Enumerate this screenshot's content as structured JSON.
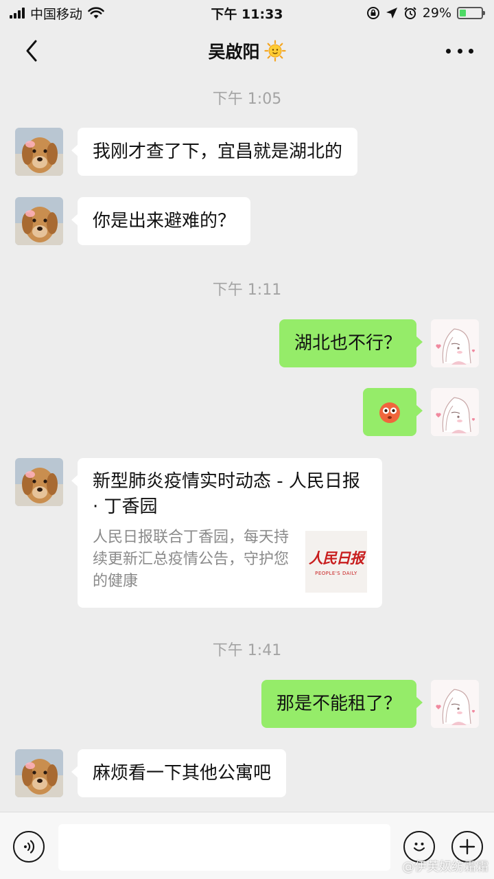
{
  "status_bar": {
    "carrier": "中国移动",
    "time": "下午 11:33",
    "battery": "29%",
    "battery_level": 0.29
  },
  "nav": {
    "title": "吴啟阳",
    "title_emoji": "sun-icon"
  },
  "chat": {
    "time_1": "下午 1:05",
    "msg_1": "我刚才查了下，宜昌就是湖北的",
    "msg_2": "你是出来避难的？",
    "time_2": "下午 1:11",
    "msg_3": "湖北也不行？",
    "msg_4_emoji": "flushed-face-icon",
    "card": {
      "title": "新型肺炎疫情实时动态 - 人民日报 · 丁香园",
      "description": "人民日报联合丁香园，每天持续更新汇总疫情公告，守护您的健康",
      "thumb_cn": "人民日报",
      "thumb_en": "PEOPLE'S DAILY"
    },
    "time_3": "下午 1:41",
    "msg_5": "那是不能租了？",
    "msg_6": "麻烦看一下其他公寓吧"
  },
  "input_bar": {
    "placeholder": ""
  },
  "watermark": "@伊芙奴纺霜霜",
  "colors": {
    "background": "#ededed",
    "outgoing_bubble": "#95ec69",
    "incoming_bubble": "#ffffff"
  }
}
